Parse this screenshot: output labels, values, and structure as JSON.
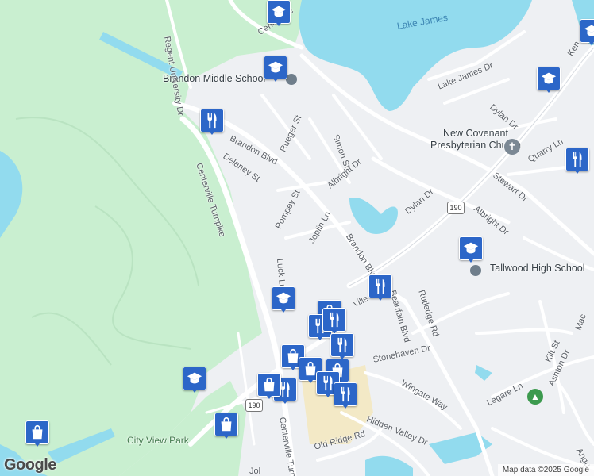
{
  "map": {
    "water_labels": {
      "lake_james": "Lake James"
    },
    "poi_labels": {
      "brandon_middle": "Brandon Middle School",
      "new_covenant": "New Covenant\nPresbyterian Church",
      "tallwood_high": "Tallwood High School",
      "city_view_park": "City View Park"
    },
    "street_labels": {
      "centerville": "Centerville",
      "regent_univ": "Regent University Dr",
      "brandon_blvd": "Brandon Blvd",
      "brandon_blvd2": "Brandon Blvd",
      "rueger": "Rueger St",
      "simon": "Simon St",
      "delaney": "Delaney St",
      "centerville_tpke": "Centerville Turnpike",
      "centerville_tpke2": "Centerville Turnpike",
      "albright": "Albright Dr",
      "albright2": "Albright Dr",
      "lake_james_dr": "Lake James Dr",
      "dylan": "Dylan Dr",
      "dylan2": "Dylan Dr",
      "quarry": "Quarry Ln",
      "stewart": "Stewart Dr",
      "pompey": "Pompey St",
      "joplin": "Joplin Ln",
      "luck": "Luck Ln",
      "rutledge": "Rutledge Rd",
      "beaufain": "Beaufain Blvd",
      "stonehaven": "Stonehaven Dr",
      "wingate": "Wingate Way",
      "hidden_valley": "Hidden Valley Dr",
      "old_ridge": "Old Ridge Rd",
      "legare": "Legare Ln",
      "ashton": "Ashton Dr",
      "kilt": "Kilt St",
      "mac": "Mac",
      "ken": "Ken",
      "angu": "Angu",
      "jol": "Jol",
      "ville": "ville"
    },
    "route_shields": [
      "190",
      "190"
    ],
    "pin_icons": [
      {
        "type": "school",
        "name": "school-pin-top"
      },
      {
        "type": "school",
        "name": "school-pin-brandon"
      },
      {
        "type": "restaurant",
        "name": "restaurant-pin-centerville"
      },
      {
        "type": "school",
        "name": "school-pin-topright"
      },
      {
        "type": "school",
        "name": "school-pin-right"
      },
      {
        "type": "restaurant",
        "name": "restaurant-pin-right"
      },
      {
        "type": "school",
        "name": "school-pin-tallwood"
      },
      {
        "type": "restaurant",
        "name": "restaurant-pin-brandon-blvd"
      },
      {
        "type": "school",
        "name": "school-pin-luck"
      },
      {
        "type": "shopping",
        "name": "shopping-pin-cluster-1"
      },
      {
        "type": "restaurant",
        "name": "restaurant-pin-cluster-1"
      },
      {
        "type": "restaurant",
        "name": "restaurant-pin-cluster-2"
      },
      {
        "type": "restaurant",
        "name": "restaurant-pin-cluster-3"
      },
      {
        "type": "shopping",
        "name": "shopping-pin-cluster-2"
      },
      {
        "type": "shopping",
        "name": "shopping-pin-cluster-3"
      },
      {
        "type": "shopping",
        "name": "shopping-pin-cluster-4"
      },
      {
        "type": "restaurant",
        "name": "restaurant-pin-cluster-4"
      },
      {
        "type": "restaurant",
        "name": "restaurant-pin-cluster-5"
      },
      {
        "type": "restaurant",
        "name": "restaurant-pin-cluster-6"
      },
      {
        "type": "shopping",
        "name": "shopping-pin-cluster-5"
      },
      {
        "type": "school",
        "name": "school-pin-cityview"
      },
      {
        "type": "shopping",
        "name": "shopping-pin-left"
      },
      {
        "type": "shopping",
        "name": "shopping-pin-cityview"
      }
    ],
    "colors": {
      "park": "#c9efd0",
      "water": "#92dbee",
      "pin": "#2c66c8",
      "road": "#ffffff",
      "land": "#eef0f3"
    }
  },
  "logo": "Google",
  "attribution": "Map data ©2025 Google"
}
